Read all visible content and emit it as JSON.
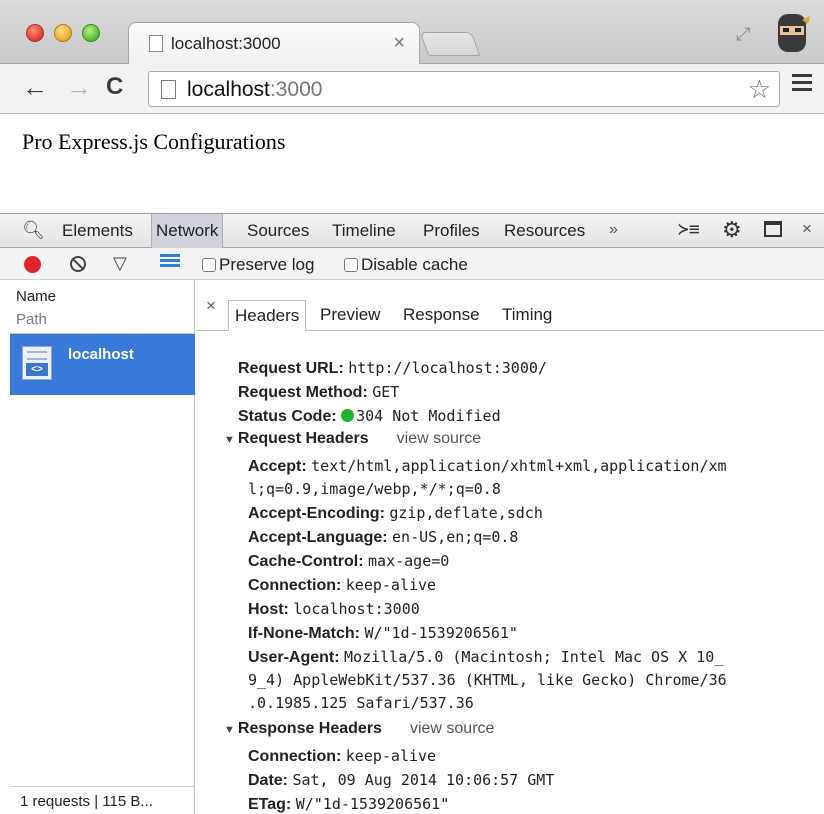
{
  "browser": {
    "tab_title": "localhost:3000",
    "tab_close": "×",
    "url_host": "localhost",
    "url_port": ":3000"
  },
  "page": {
    "heading": "Pro Express.js Configurations"
  },
  "devtools": {
    "tabs": [
      "Elements",
      "Network",
      "Sources",
      "Timeline",
      "Profiles",
      "Resources"
    ],
    "more": "»",
    "preserve_log": "Preserve log",
    "disable_cache": "Disable cache",
    "list_columns": {
      "name": "Name",
      "path": "Path"
    },
    "request": {
      "name": "localhost"
    },
    "summary": "1 requests | 115 B...",
    "detail_tabs": [
      "Headers",
      "Preview",
      "Response",
      "Timing"
    ],
    "general": [
      {
        "key": "Request URL:",
        "value": "http://localhost:3000/"
      },
      {
        "key": "Request Method:",
        "value": "GET"
      },
      {
        "key": "Status Code:",
        "value": "304 Not Modified"
      }
    ],
    "request_headers_title": "Request Headers",
    "response_headers_title": "Response Headers",
    "view_source": "view source",
    "request_headers": {
      "accept_key": "Accept:",
      "accept_l1": "text/html,application/xhtml+xml,application/xm",
      "accept_l2": "l;q=0.9,image/webp,*/*;q=0.8",
      "encoding_key": "Accept-Encoding:",
      "encoding_val": "gzip,deflate,sdch",
      "language_key": "Accept-Language:",
      "language_val": "en-US,en;q=0.8",
      "cache_key": "Cache-Control:",
      "cache_val": "max-age=0",
      "connection_key": "Connection:",
      "connection_val": "keep-alive",
      "host_key": "Host:",
      "host_val": "localhost:3000",
      "inm_key": "If-None-Match:",
      "inm_val": "W/\"1d-1539206561\"",
      "ua_key": "User-Agent:",
      "ua_l1": "Mozilla/5.0 (Macintosh; Intel Mac OS X 10_",
      "ua_l2": "9_4) AppleWebKit/537.36 (KHTML, like Gecko) Chrome/36",
      "ua_l3": ".0.1985.125 Safari/537.36"
    },
    "response_headers": {
      "connection_key": "Connection:",
      "connection_val": "keep-alive",
      "date_key": "Date:",
      "date_val": "Sat, 09 Aug 2014 10:06:57 GMT",
      "etag_key": "ETag:",
      "etag_val": "W/\"1d-1539206561\""
    }
  },
  "colors": {
    "selected_row": "#3879d9",
    "record_red": "#e0242d",
    "status_green": "#1fb32e"
  }
}
